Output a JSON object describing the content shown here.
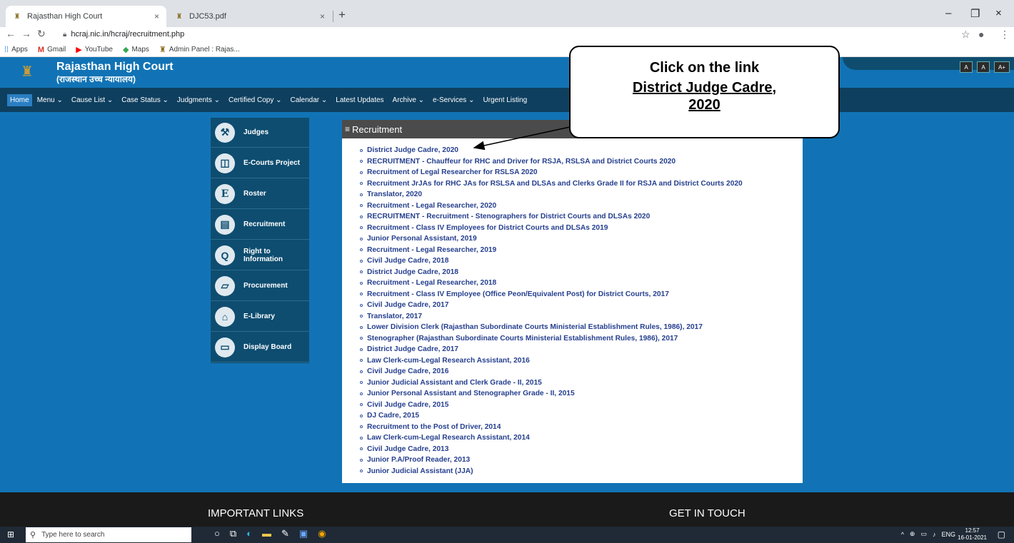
{
  "browser": {
    "tabs": [
      {
        "title": "Rajasthan High Court",
        "icon": "court-emblem-icon",
        "active": true
      },
      {
        "title": "DJC53.pdf",
        "icon": "court-emblem-icon",
        "active": false
      }
    ],
    "new_tab": "+",
    "close_glyph": "×",
    "window_controls": {
      "minimize": "–",
      "maximize": "❐",
      "close": "×"
    },
    "url": "hcraj.nic.in/hcraj/recruitment.php",
    "bookmarks": [
      {
        "label": "Apps",
        "icon": "apps-grid-icon"
      },
      {
        "label": "Gmail",
        "icon": "gmail-icon"
      },
      {
        "label": "YouTube",
        "icon": "youtube-icon"
      },
      {
        "label": "Maps",
        "icon": "maps-icon"
      },
      {
        "label": "Admin Panel : Rajas...",
        "icon": "court-emblem-icon"
      }
    ]
  },
  "site": {
    "title": "Rajasthan High Court",
    "subtitle": "(राजस्थान उच्च न्यायालय)",
    "font_buttons": [
      "A",
      "A",
      "A+"
    ],
    "nav": [
      "Home",
      "Menu ⌄",
      "Cause List ⌄",
      "Case Status ⌄",
      "Judgments ⌄",
      "Certified Copy ⌄",
      "Calendar ⌄",
      "Latest Updates",
      "Archive ⌄",
      "e-Services ⌄",
      "Urgent Listing"
    ],
    "sidebar": [
      {
        "label": "Judges",
        "icon": "gavel-icon",
        "glyph": "⚒"
      },
      {
        "label": "E-Courts Project",
        "icon": "ecourts-icon",
        "glyph": "◫"
      },
      {
        "label": "Roster",
        "icon": "roster-icon",
        "glyph": "E"
      },
      {
        "label": "Recruitment",
        "icon": "id-card-icon",
        "glyph": "▤"
      },
      {
        "label": "Right to Information",
        "icon": "search-icon",
        "glyph": "Q"
      },
      {
        "label": "Procurement",
        "icon": "procurement-icon",
        "glyph": "▱"
      },
      {
        "label": "E-Library",
        "icon": "library-icon",
        "glyph": "⌂"
      },
      {
        "label": "Display Board",
        "icon": "monitor-icon",
        "glyph": "▭"
      }
    ],
    "panel_title": "Recruitment",
    "recruitments": [
      "District Judge Cadre, 2020",
      "RECRUITMENT - Chauffeur for RHC and Driver for RSJA, RSLSA and District Courts 2020",
      "Recruitment of Legal Researcher for RSLSA 2020",
      "Recruitment JrJAs for RHC JAs for RSLSA and DLSAs and Clerks Grade II for RSJA and District Courts 2020",
      "Translator, 2020",
      "Recruitment - Legal Researcher, 2020",
      "RECRUITMENT - Recruitment - Stenographers for District Courts and DLSAs 2020",
      "Recruitment - Class IV Employees for District Courts and DLSAs 2019",
      "Junior Personal Assistant, 2019",
      "Recruitment - Legal Researcher, 2019",
      "Civil Judge Cadre, 2018",
      "District Judge Cadre, 2018",
      "Recruitment - Legal Researcher, 2018",
      "Recruitment - Class IV Employee (Office Peon/Equivalent Post) for District Courts, 2017",
      "Civil Judge Cadre, 2017",
      "Translator, 2017",
      "Lower Division Clerk (Rajasthan Subordinate Courts Ministerial Establishment Rules, 1986), 2017",
      "Stenographer (Rajasthan Subordinate Courts Ministerial Establishment Rules, 1986), 2017",
      "District Judge Cadre, 2017",
      "Law Clerk-cum-Legal Research Assistant, 2016",
      "Civil Judge Cadre, 2016",
      "Junior Judicial Assistant and Clerk Grade - II, 2015",
      "Junior Personal Assistant and Stenographer Grade - II, 2015",
      "Civil Judge Cadre, 2015",
      "DJ Cadre, 2015",
      "Recruitment to the Post of Driver, 2014",
      "Law Clerk-cum-Legal Research Assistant, 2014",
      "Civil Judge Cadre, 2013",
      "Junior P.A/Proof Reader, 2013",
      "Junior Judicial Assistant (JJA)"
    ],
    "footer": {
      "important_links": "IMPORTANT LINKS",
      "get_in_touch": "GET IN TOUCH"
    }
  },
  "callout": {
    "line1": "Click on the link",
    "line2": "District Judge Cadre,",
    "line3": "2020"
  },
  "taskbar": {
    "search_placeholder": "Type here to search",
    "language": "ENG",
    "time": "12:57",
    "date": "16-01-2021"
  }
}
